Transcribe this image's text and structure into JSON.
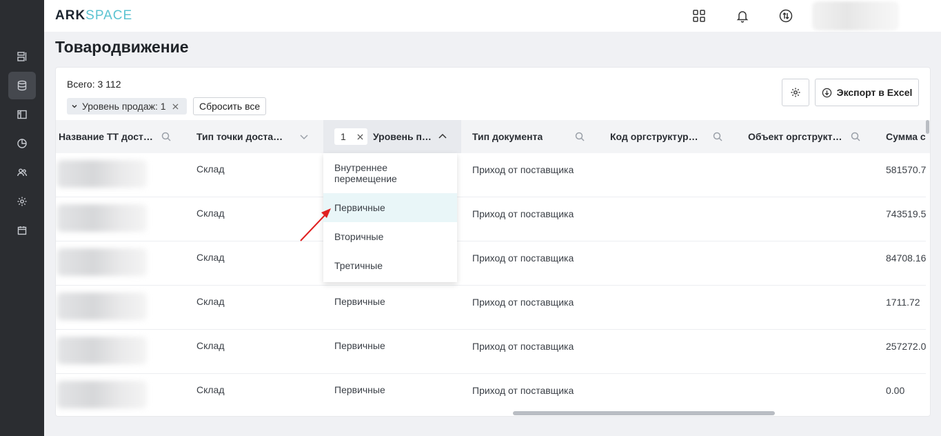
{
  "logo": {
    "part1": "ARK",
    "part2": "SPACE"
  },
  "page_title": "Товародвижение",
  "total": "Всего: 3 112",
  "filter_chip": "Уровень продаж: 1",
  "reset_label": "Сбросить все",
  "export_label": "Экспорт в Excel",
  "columns": [
    {
      "label": "Название ТТ дост…",
      "icon": "search-icon"
    },
    {
      "label": "Тип точки доста…",
      "icon": "chevron-down-icon"
    },
    {
      "label": "Уровень п…",
      "icon": "chevron-up-icon",
      "filter_value": "1"
    },
    {
      "label": "Тип документа",
      "icon": "search-icon"
    },
    {
      "label": "Код оргструктур…",
      "icon": "search-icon"
    },
    {
      "label": "Объект оргструкт…",
      "icon": "search-icon"
    },
    {
      "label": "Сумма с",
      "icon": ""
    }
  ],
  "rows": [
    {
      "type": "Склад",
      "level": "",
      "doc": "Приход от поставщика",
      "sum": "581570.7"
    },
    {
      "type": "Склад",
      "level": "",
      "doc": "Приход от поставщика",
      "sum": "743519.5"
    },
    {
      "type": "Склад",
      "level": "",
      "doc": "Приход от поставщика",
      "sum": "84708.16"
    },
    {
      "type": "Склад",
      "level": "Первичные",
      "doc": "Приход от поставщика",
      "sum": "1711.72"
    },
    {
      "type": "Склад",
      "level": "Первичные",
      "doc": "Приход от поставщика",
      "sum": "257272.0"
    },
    {
      "type": "Склад",
      "level": "Первичные",
      "doc": "Приход от поставщика",
      "sum": "0.00"
    }
  ],
  "dropdown_options": [
    "Внутреннее перемещение",
    "Первичные",
    "Вторичные",
    "Третичные"
  ],
  "highlighted_option": "Первичные",
  "colors": {
    "sidebar": "#2b2d31",
    "accent": "#5bc3d1",
    "highlight": "#e9f6f8",
    "arrow": "#e02020"
  }
}
